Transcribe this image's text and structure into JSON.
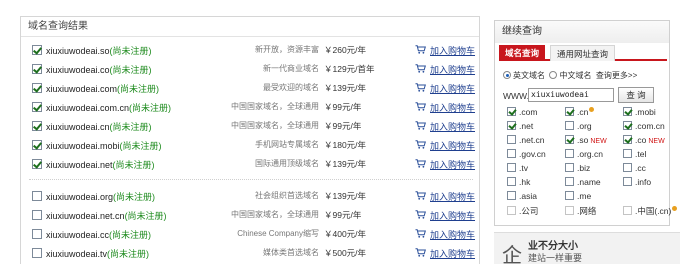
{
  "results": {
    "title": "域名查询结果",
    "registered_label": "(尚未注册)",
    "cart_label": "加入购物车",
    "rows": [
      {
        "domain": "xiuxiuwodeai.so",
        "desc": "新开放，资源丰富",
        "price": "￥260元/年",
        "checked": true
      },
      {
        "domain": "xiuxiuwodeai.co",
        "desc": "新一代商业域名",
        "price": "￥129元/首年",
        "checked": true
      },
      {
        "domain": "xiuxiuwodeai.com",
        "desc": "最受欢迎的域名",
        "price": "￥139元/年",
        "checked": true
      },
      {
        "domain": "xiuxiuwodeai.com.cn",
        "desc": "中国国家域名，全球通用",
        "price": "￥99元/年",
        "checked": true
      },
      {
        "domain": "xiuxiuwodeai.cn",
        "desc": "中国国家域名，全球通用",
        "price": "￥99元/年",
        "checked": true
      },
      {
        "domain": "xiuxiuwodeai.mobi",
        "desc": "手机网站专属域名",
        "price": "￥180元/年",
        "checked": true
      },
      {
        "domain": "xiuxiuwodeai.net",
        "desc": "国际通用顶级域名",
        "price": "￥139元/年",
        "checked": true
      },
      {
        "domain": "xiuxiuwodeai.org",
        "desc": "社会组织首选域名",
        "price": "￥139元/年",
        "checked": false
      },
      {
        "domain": "xiuxiuwodeai.net.cn",
        "desc": "中国国家域名，全球通用",
        "price": "￥99元/年",
        "checked": false
      },
      {
        "domain": "xiuxiuwodeai.cc",
        "desc": "Chinese Company缩写",
        "price": "￥400元/年",
        "checked": false
      },
      {
        "domain": "xiuxiuwodeai.tv",
        "desc": "媒体类首选域名",
        "price": "￥500元/年",
        "checked": false
      }
    ]
  },
  "continue": {
    "title": "继续查询",
    "tab_domain": "域名查询",
    "tab_general": "通用网址查询",
    "radio_english": "英文域名",
    "radio_chinese": "中文域名",
    "more": "查询更多>>",
    "www_label": "WWW.",
    "input_value": "xiuxiuwodeai",
    "query_button": "查 询",
    "extensions": [
      [
        {
          "label": ".com",
          "checked": true,
          "hot": false,
          "new": false
        },
        {
          "label": ".cn",
          "checked": true,
          "hot": true,
          "new": false
        },
        {
          "label": ".mobi",
          "checked": true,
          "hot": false,
          "new": false
        }
      ],
      [
        {
          "label": ".net",
          "checked": true,
          "hot": false,
          "new": false
        },
        {
          "label": ".org",
          "checked": false,
          "hot": false,
          "new": false
        },
        {
          "label": ".com.cn",
          "checked": true,
          "hot": false,
          "new": false
        }
      ],
      [
        {
          "label": ".net.cn",
          "checked": false,
          "hot": false,
          "new": false
        },
        {
          "label": ".so",
          "checked": true,
          "hot": false,
          "new": true
        },
        {
          "label": ".co",
          "checked": true,
          "hot": false,
          "new": true
        }
      ],
      [
        {
          "label": ".gov.cn",
          "checked": false,
          "hot": false,
          "new": false
        },
        {
          "label": ".org.cn",
          "checked": false,
          "hot": false,
          "new": false
        },
        {
          "label": ".tel",
          "checked": false,
          "hot": false,
          "new": false
        }
      ],
      [
        {
          "label": ".tv",
          "checked": false,
          "hot": false,
          "new": false
        },
        {
          "label": ".biz",
          "checked": false,
          "hot": false,
          "new": false
        },
        {
          "label": ".cc",
          "checked": false,
          "hot": false,
          "new": false
        }
      ],
      [
        {
          "label": ".hk",
          "checked": false,
          "hot": false,
          "new": false
        },
        {
          "label": ".name",
          "checked": false,
          "hot": false,
          "new": false
        },
        {
          "label": ".info",
          "checked": false,
          "hot": false,
          "new": false
        }
      ],
      [
        {
          "label": ".asia",
          "checked": false,
          "hot": false,
          "new": false
        },
        {
          "label": ".me",
          "checked": false,
          "hot": false,
          "new": false
        },
        null
      ],
      [
        {
          "label": ".公司",
          "checked": false,
          "hot": false,
          "new": false,
          "light": true
        },
        {
          "label": ".网络",
          "checked": false,
          "hot": false,
          "new": false,
          "light": true
        },
        {
          "label": ".中国(.cn)",
          "checked": false,
          "hot": true,
          "new": false,
          "light": true
        }
      ]
    ],
    "new_badge": "NEW"
  },
  "ad": {
    "mark": "企",
    "line1": "业不分大小",
    "line2": "建站一样重要"
  },
  "colors": {
    "accent": "#c8161d",
    "link": "#1f3f8f",
    "registered": "#1c8a1c"
  }
}
